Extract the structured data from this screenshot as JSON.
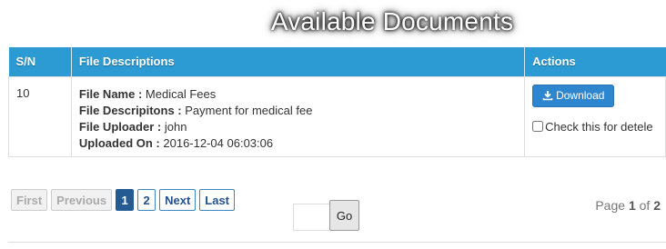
{
  "page": {
    "title": "Available Documents"
  },
  "table": {
    "headers": {
      "sn": "S/N",
      "desc": "File Descriptions",
      "actions": "Actions"
    },
    "rows": [
      {
        "sn": "10",
        "file_name_label": "File Name :",
        "file_name": "Medical Fees",
        "file_desc_label": "File Descripitons :",
        "file_desc": "Payment for medical fee",
        "uploader_label": "File Uploader :",
        "uploader": "john",
        "uploaded_label": "Uploaded On :",
        "uploaded_on": "2016-12-04 06:03:06",
        "download_label": "Download",
        "delete_check_label": "Check this for detele"
      }
    ]
  },
  "pagination": {
    "first": "First",
    "previous": "Previous",
    "page1": "1",
    "page2": "2",
    "next": "Next",
    "last": "Last"
  },
  "goto": {
    "value": "",
    "button": "Go"
  },
  "page_info": {
    "prefix": "Page",
    "current": "1",
    "of": "of",
    "total": "2"
  },
  "colors": {
    "header_bg": "#2c9bd3",
    "active_page": "#245b92",
    "download_btn": "#2e86cf"
  }
}
